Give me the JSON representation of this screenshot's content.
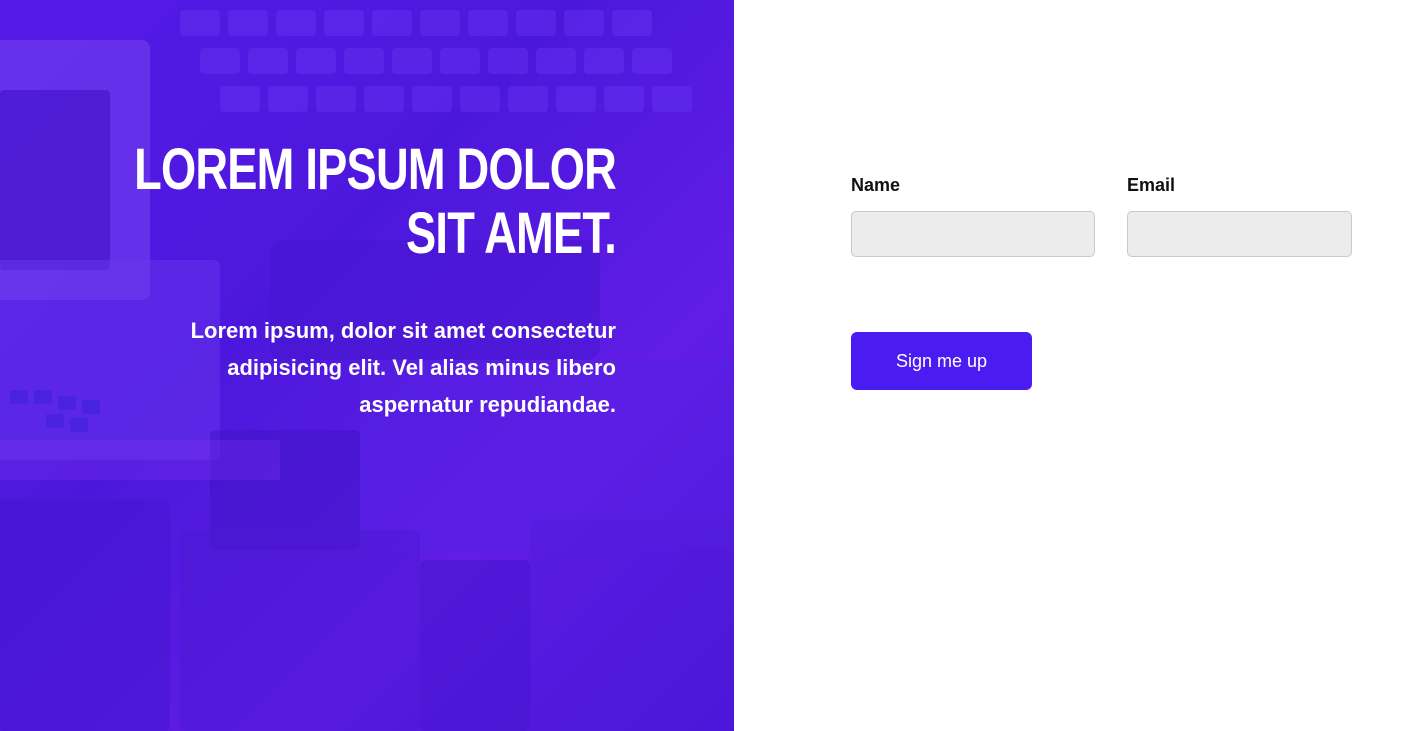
{
  "hero": {
    "title": "LOREM IPSUM DOLOR SIT AMET.",
    "text": "Lorem ipsum, dolor sit amet consectetur adipisicing elit. Vel alias minus libero aspernatur repudiandae.",
    "overlay_color": "#5a1ee8"
  },
  "form": {
    "name_label": "Name",
    "email_label": "Email",
    "name_value": "",
    "email_value": "",
    "submit_label": "Sign me up",
    "button_color": "#4b1cf2",
    "input_bg": "#ececec"
  }
}
